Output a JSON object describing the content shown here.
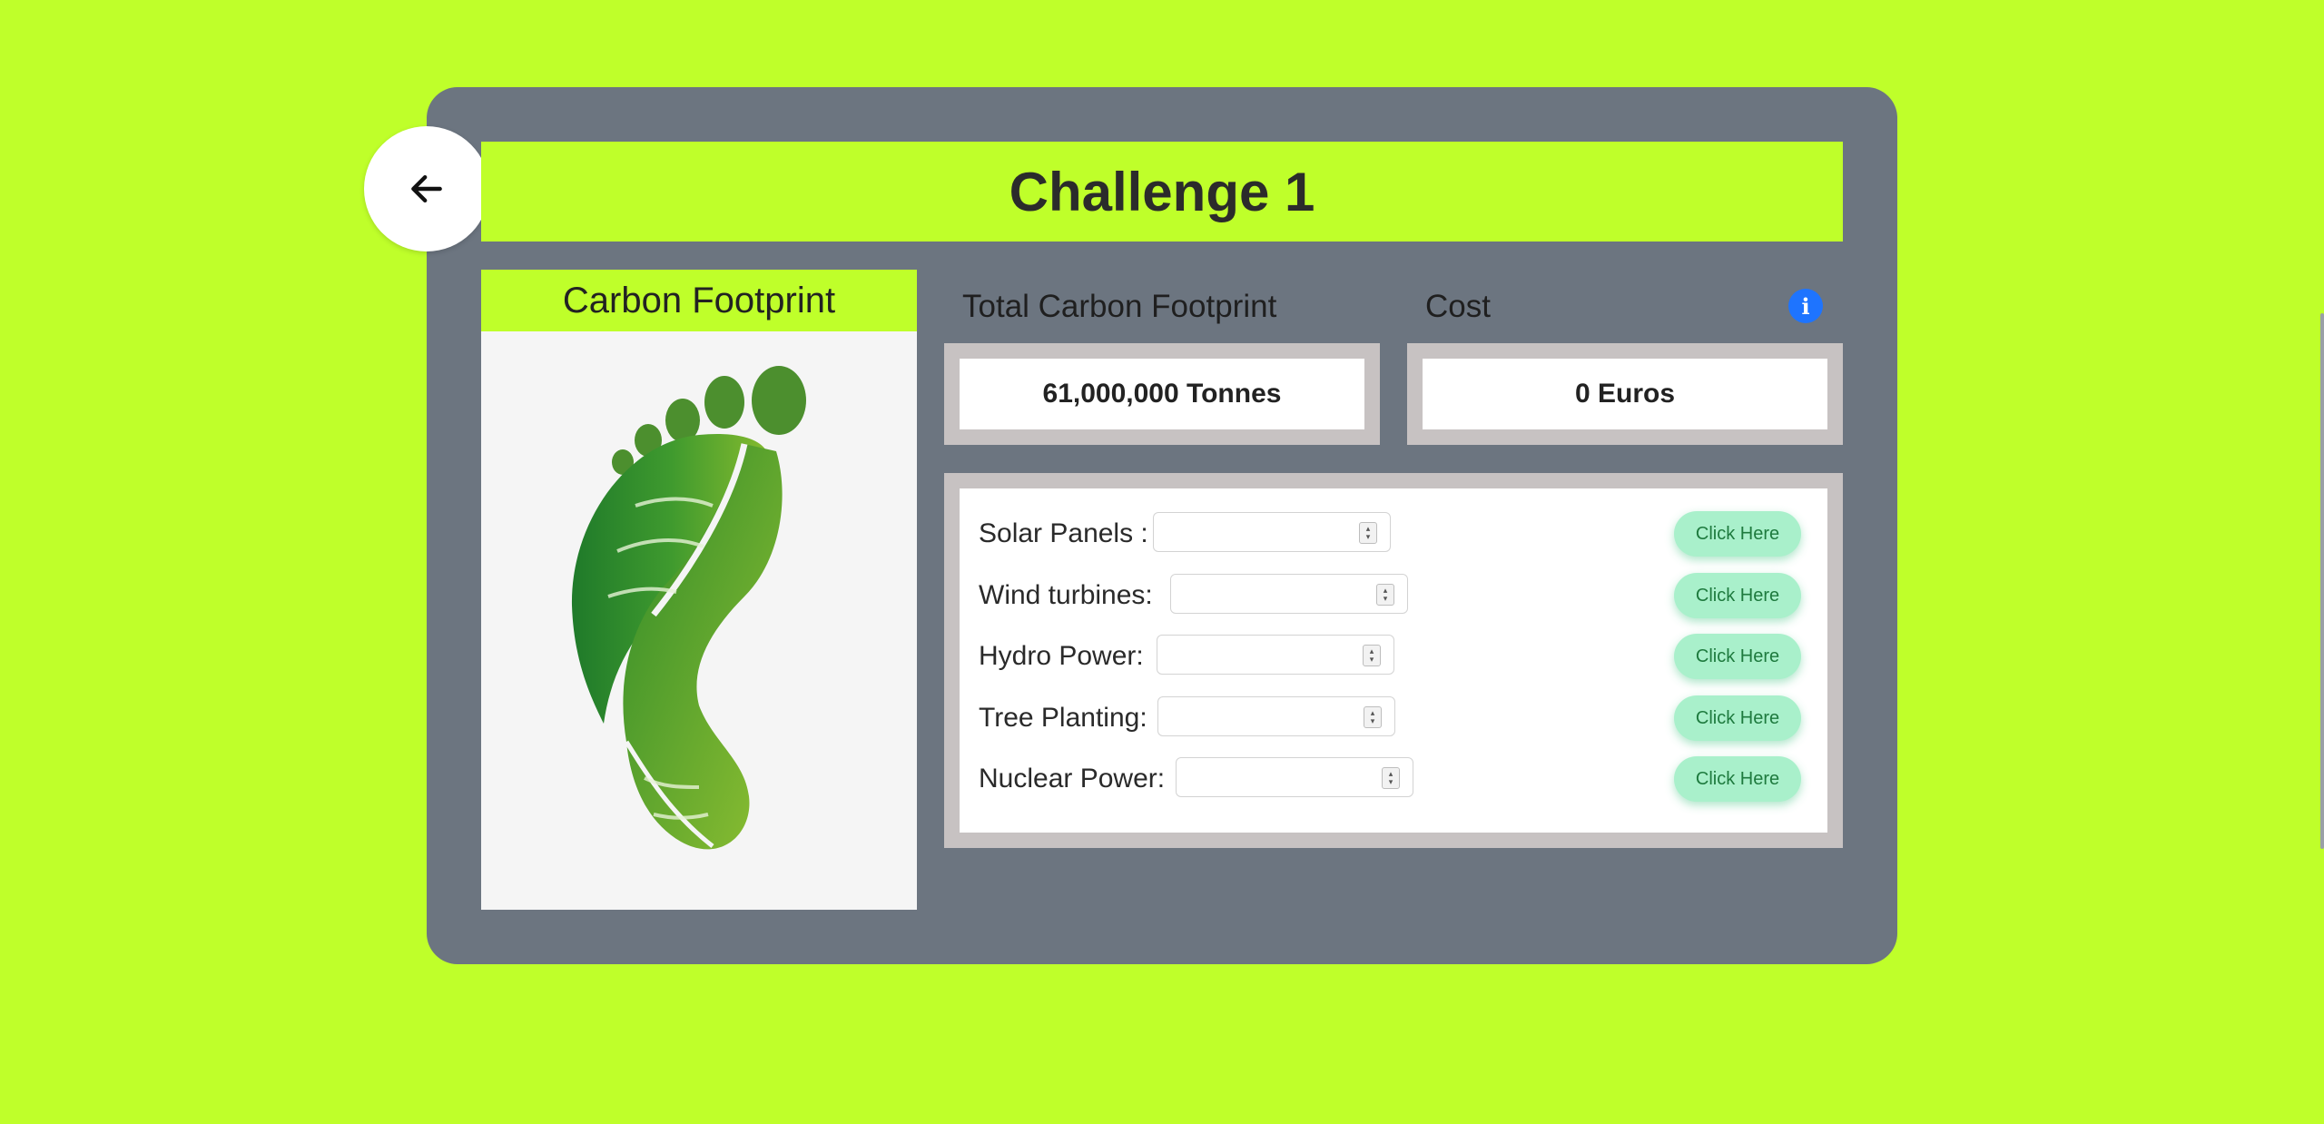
{
  "page": {
    "title": "Challenge 1",
    "colors": {
      "background": "#bfff2a",
      "card": "#6c7580",
      "accent": "#bfff2a",
      "button": "#a9f0cb"
    }
  },
  "back_button": {
    "icon": "arrow-left-icon"
  },
  "footprint": {
    "title": "Carbon Footprint",
    "image": "green-leaf-footprint"
  },
  "stats": {
    "total_label": "Total Carbon Footprint",
    "total_value": "61,000,000 Tonnes",
    "cost_label": "Cost",
    "cost_value": "0 Euros",
    "info_icon": "info-icon"
  },
  "options": [
    {
      "label": "Solar Panels :",
      "value": "",
      "button": "Click Here"
    },
    {
      "label": "Wind turbines:",
      "value": "",
      "button": "Click Here"
    },
    {
      "label": "Hydro Power:",
      "value": "",
      "button": "Click Here"
    },
    {
      "label": "Tree Planting:",
      "value": "",
      "button": "Click Here"
    },
    {
      "label": "Nuclear Power:",
      "value": "",
      "button": "Click Here"
    }
  ]
}
